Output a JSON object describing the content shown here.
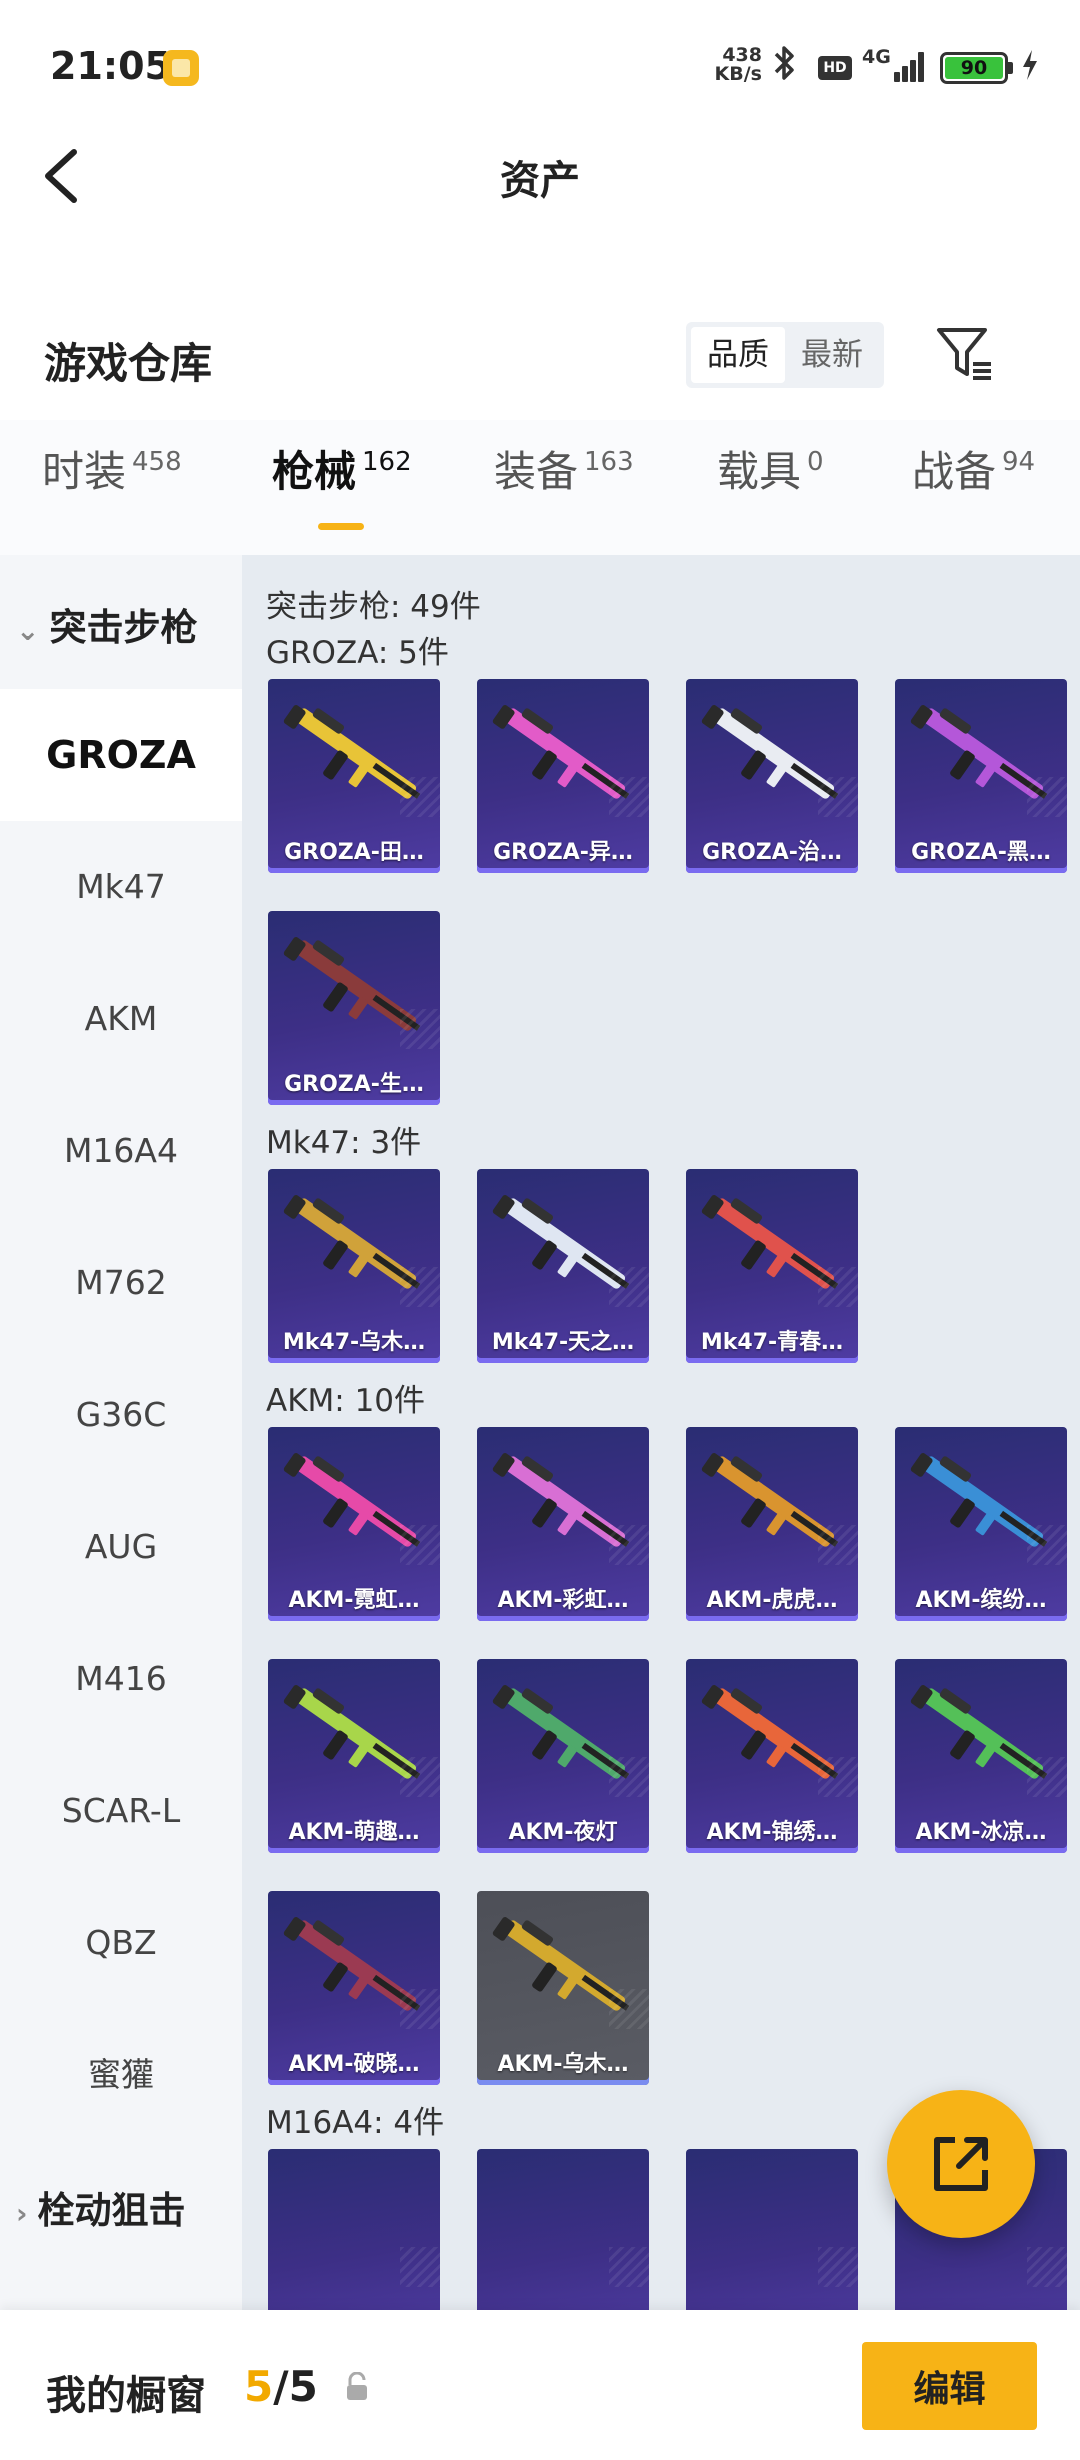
{
  "status_bar": {
    "time": "21:05",
    "net_speed_value": "438",
    "net_speed_unit": "KB/s",
    "hd_badge": "HD",
    "network_type": "4G",
    "battery_level": "90"
  },
  "header": {
    "title": "资产"
  },
  "section": {
    "title": "游戏仓库",
    "sort_options": [
      "品质",
      "最新"
    ],
    "selected_sort": "品质"
  },
  "tabs": [
    {
      "label": "时装",
      "count": "458"
    },
    {
      "label": "枪械",
      "count": "162"
    },
    {
      "label": "装备",
      "count": "163"
    },
    {
      "label": "载具",
      "count": "0"
    },
    {
      "label": "战备",
      "count": "94"
    }
  ],
  "active_tab": "枪械",
  "sidebar": {
    "group_label": "突击步枪",
    "items": [
      "GROZA",
      "Mk47",
      "AKM",
      "M16A4",
      "M762",
      "G36C",
      "AUG",
      "M416",
      "SCAR-L",
      "QBZ",
      "蜜獾"
    ],
    "selected_item": "GROZA",
    "next_group_label": "栓动狙击"
  },
  "content": {
    "group_heading": "突击步枪: 49件",
    "categories": [
      {
        "heading": "GROZA: 5件",
        "items": [
          {
            "label": "GROZA-田…",
            "accent": "#e8c437"
          },
          {
            "label": "GROZA-异…",
            "accent": "#e25bc8"
          },
          {
            "label": "GROZA-治…",
            "accent": "#e9ecf2"
          },
          {
            "label": "GROZA-黑…",
            "accent": "#b457d9"
          },
          {
            "label": "GROZA-生…",
            "accent": "#8a3b3b"
          }
        ]
      },
      {
        "heading": "Mk47: 3件",
        "items": [
          {
            "label": "Mk47-乌木…",
            "accent": "#d0a23a"
          },
          {
            "label": "Mk47-天之…",
            "accent": "#dfe6f2"
          },
          {
            "label": "Mk47-青春…",
            "accent": "#e0524c"
          }
        ]
      },
      {
        "heading": "AKM: 10件",
        "items": [
          {
            "label": "AKM-霓虹…",
            "accent": "#e64aa8"
          },
          {
            "label": "AKM-彩虹…",
            "accent": "#d86fd4"
          },
          {
            "label": "AKM-虎虎…",
            "accent": "#d9942f"
          },
          {
            "label": "AKM-缤纷…",
            "accent": "#3a8fd6"
          },
          {
            "label": "AKM-萌趣…",
            "accent": "#a8d64a"
          },
          {
            "label": "AKM-夜灯",
            "accent": "#4fa96b"
          },
          {
            "label": "AKM-锦绣…",
            "accent": "#e8663a"
          },
          {
            "label": "AKM-冰凉…",
            "accent": "#54c058"
          },
          {
            "label": "AKM-破晓…",
            "accent": "#9b3a52"
          },
          {
            "label": "AKM-乌木…",
            "accent": "#d3a92e",
            "grey": true
          }
        ]
      },
      {
        "heading": "M16A4: 4件",
        "items": []
      }
    ]
  },
  "showcase": {
    "label": "我的橱窗",
    "current": "5",
    "total": "/5",
    "edit_label": "编辑"
  }
}
